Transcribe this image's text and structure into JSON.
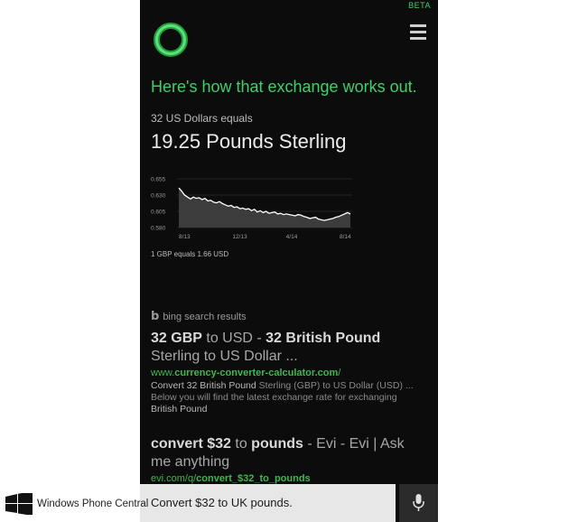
{
  "beta_label": "BETA",
  "headline": "Here's how that exchange works out.",
  "conversion": {
    "from_text": "32 US Dollars equals",
    "result_text": "19.25 Pounds Sterling",
    "rate_note": "1 GBP equals 1.66 USD"
  },
  "chart_data": {
    "type": "line",
    "x_tick_labels": [
      "8/13",
      "12/13",
      "4/14",
      "8/14"
    ],
    "y_tick_labels": [
      "0.655",
      "0.630",
      "0.605",
      "0.580"
    ],
    "ylim": [
      0.58,
      0.655
    ],
    "grid": true,
    "series": [
      {
        "values": [
          0.641,
          0.636,
          0.63,
          0.627,
          0.624,
          0.627,
          0.625,
          0.626,
          0.623,
          0.625,
          0.621,
          0.622,
          0.619,
          0.618,
          0.62,
          0.617,
          0.615,
          0.613,
          0.614,
          0.611,
          0.612,
          0.609,
          0.61,
          0.608,
          0.609,
          0.606,
          0.608,
          0.604,
          0.606,
          0.603,
          0.605,
          0.602,
          0.603,
          0.604,
          0.601,
          0.602,
          0.6,
          0.601,
          0.6,
          0.599,
          0.598,
          0.6,
          0.599,
          0.597,
          0.596,
          0.594,
          0.595,
          0.596,
          0.593,
          0.592,
          0.591,
          0.592,
          0.593,
          0.594,
          0.596,
          0.597,
          0.599,
          0.601,
          0.603,
          0.601
        ]
      }
    ]
  },
  "bing_label": "bing search results",
  "results": [
    {
      "title_bold_1": "32 GBP",
      "title_mid": " to USD - ",
      "title_bold_2": "32 British Pound",
      "title_rest": " Sterling to US Dollar ...",
      "url_prefix": "www.",
      "url_bold": "currency-converter-calculator.com",
      "url_suffix": "/",
      "snippet_a": "Convert 32 British Pound",
      "snippet_b": " Sterling (GBP) to US Dollar (USD) ...",
      "snippet_c": "Below you will find the latest exchange rate for exchanging",
      "snippet_d": "British Pound"
    },
    {
      "title_bold_1": "convert $32",
      "title_mid": " to ",
      "title_bold_2": "pounds",
      "title_rest": " - Evi - Evi | Ask me anything",
      "url_prefix": "evi.com/q/",
      "url_bold": "convert_$32_to_pounds",
      "url_suffix": ""
    }
  ],
  "query": "Convert $32 to UK pounds.",
  "watermark": "Windows Phone Central",
  "colors": {
    "accent": "#3fd06a",
    "background": "#0c0c0c",
    "link": "#3fb84f"
  }
}
